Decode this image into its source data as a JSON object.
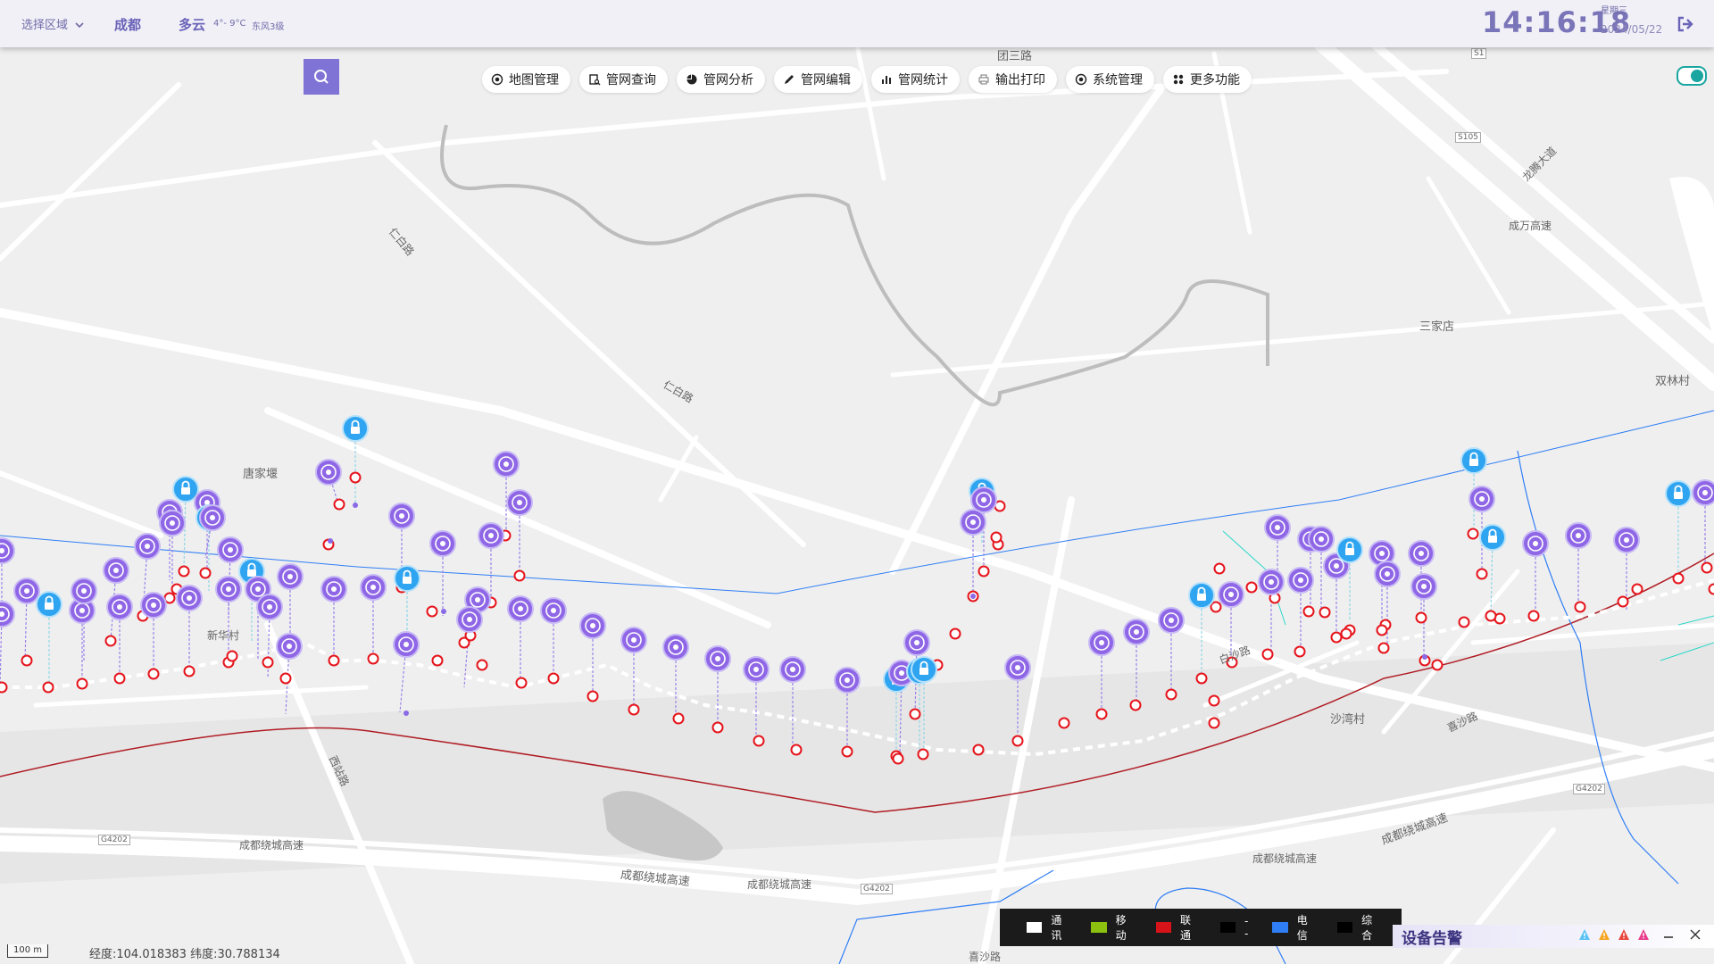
{
  "header": {
    "region_select": "选择区域",
    "city": "成都",
    "weather": "多云",
    "temperature": "4°- 9°C",
    "wind": "东风3级",
    "time": "14:16:18",
    "weekday": "星期三",
    "date": "2024/05/22"
  },
  "icons": {
    "search": "search-icon",
    "logout": "logout-icon",
    "chevron": "chevron-down-icon"
  },
  "menu": [
    {
      "label": "地图管理",
      "icon": "map-icon"
    },
    {
      "label": "管网查询",
      "icon": "query-icon"
    },
    {
      "label": "管网分析",
      "icon": "pie-chart-icon"
    },
    {
      "label": "管网编辑",
      "icon": "edit-icon"
    },
    {
      "label": "管网统计",
      "icon": "bar-chart-icon"
    },
    {
      "label": "输出打印",
      "icon": "printer-icon"
    },
    {
      "label": "系统管理",
      "icon": "settings-icon"
    },
    {
      "label": "更多功能",
      "icon": "grid-icon"
    }
  ],
  "map_labels": {
    "l1": "团三路",
    "l2": "成万高速",
    "l3": "龙腾大道",
    "l4": "三家店",
    "l5": "双林村",
    "l6": "唐家堰",
    "l7": "仁白路",
    "l8": "仁白路",
    "l9": "沙湾村",
    "l10": "喜沙路",
    "l11": "成都绕城高速",
    "l12": "成都绕城高速",
    "l13": "成都绕城高速",
    "l14": "成都绕城高速",
    "l15": "成都绕城高速",
    "l16": "西站路",
    "l17": "喜沙路",
    "l18": "S105",
    "l19": "G4202",
    "l20": "G4202",
    "l21": "G4202",
    "l22": "白沙路",
    "l23": "S1",
    "l24": "新华村"
  },
  "legend": [
    {
      "label": "通讯",
      "color": "#ffffff"
    },
    {
      "label": "移动",
      "color": "#8cc20f"
    },
    {
      "label": "联通",
      "color": "#d7131a"
    },
    {
      "label": "--",
      "color": "#000000"
    },
    {
      "label": "电信",
      "color": "#2f7ef5"
    },
    {
      "label": "综合",
      "color": "#000000"
    }
  ],
  "alarm": {
    "title": "设备告警",
    "levels": [
      "#59c2f5",
      "#f5a623",
      "#e8453c",
      "#e83c8c"
    ]
  },
  "scale_bar": "100 m",
  "coordinates": "经度:104.018383 纬度:30.788134",
  "colors": {
    "accent": "#7f73d6",
    "marker_purple": "#8f67e6",
    "marker_blue": "#2fa4f0",
    "node_red": "#e5141b",
    "line_red": "#b01c24",
    "line_blue": "#2f7ef5"
  }
}
